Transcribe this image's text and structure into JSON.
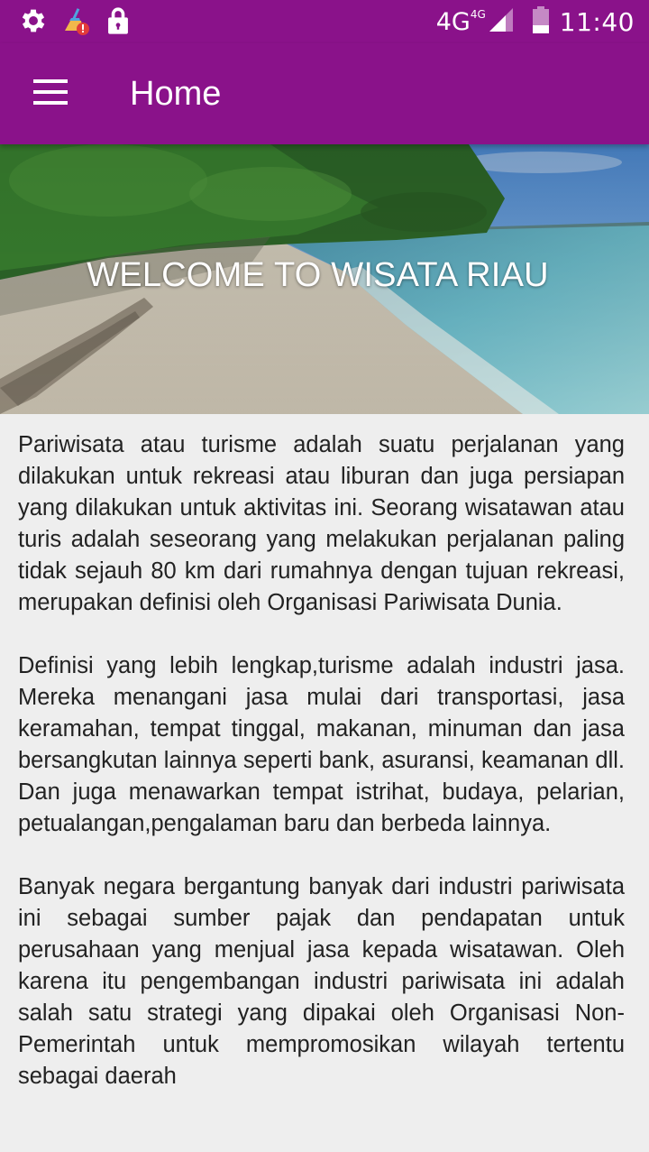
{
  "status_bar": {
    "left_icons": [
      "settings-gear-icon",
      "cleaner-broom-alert-icon",
      "lock-icon"
    ],
    "network_label": "4G",
    "network_sup": "4G",
    "time": "11:40"
  },
  "app_bar": {
    "title": "Home",
    "menu_icon": "hamburger-menu-icon",
    "background": "#8a128a"
  },
  "hero": {
    "title": "WELCOME TO WISATA RIAU",
    "image": "beach-shoreline-image"
  },
  "content": {
    "paragraphs": [
      "Pariwisata atau turisme adalah suatu perjalanan yang dilakukan untuk rekreasi atau liburan dan juga persiapan yang dilakukan untuk aktivitas ini. Seorang wisatawan atau turis adalah seseorang yang melakukan perjalanan paling tidak sejauh 80 km dari rumahnya dengan tujuan rekreasi, merupakan definisi oleh Organisasi Pariwisata Dunia.",
      "Definisi yang lebih lengkap,turisme adalah industri jasa. Mereka menangani jasa mulai dari transportasi, jasa keramahan, tempat tinggal, makanan, minuman dan jasa bersangkutan lainnya seperti bank, asuransi, keamanan dll. Dan juga menawarkan tempat istrihat, budaya, pelarian, petualangan,pengalaman baru dan berbeda lainnya.",
      "Banyak negara bergantung banyak dari industri pariwisata ini sebagai sumber pajak dan pendapatan untuk perusahaan yang menjual jasa kepada wisatawan. Oleh karena itu pengembangan industri pariwisata ini adalah salah satu strategi yang dipakai oleh Organisasi Non-Pemerintah untuk mempromosikan wilayah tertentu sebagai daerah"
    ]
  }
}
